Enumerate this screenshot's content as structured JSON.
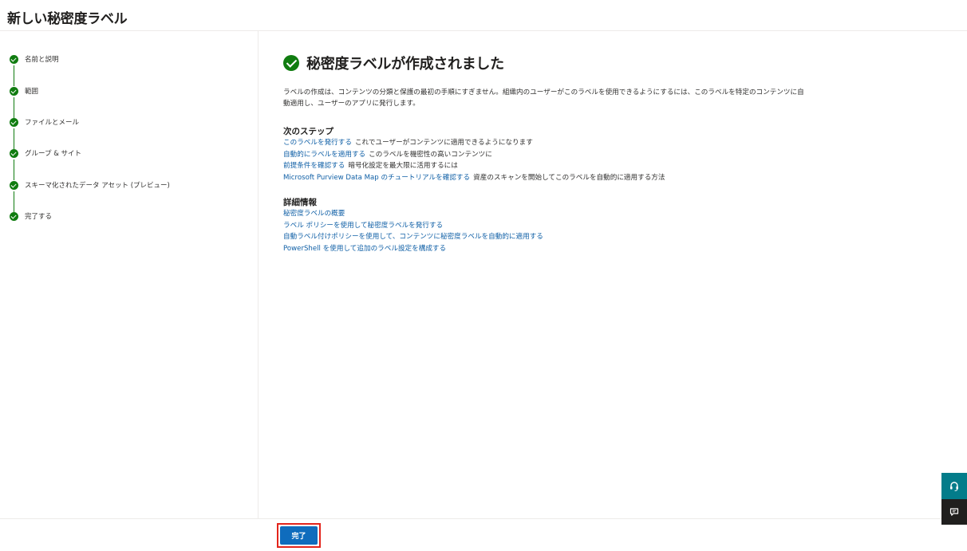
{
  "header": {
    "title": "新しい秘密度ラベル"
  },
  "steps": [
    {
      "label": "名前と説明"
    },
    {
      "label": "範囲"
    },
    {
      "label": "ファイルとメール"
    },
    {
      "label": "グループ & サイト"
    },
    {
      "label": "スキーマ化されたデータ アセット (プレビュー)"
    },
    {
      "label": "完了する"
    }
  ],
  "main": {
    "title": "秘密度ラベルが作成されました",
    "description": "ラベルの作成は、コンテンツの分類と保護の最初の手順にすぎません。組織内のユーザーがこのラベルを使用できるようにするには、このラベルを特定のコンテンツに自動適用し、ユーザーのアプリに発行します。",
    "next_steps": {
      "heading": "次のステップ",
      "items": [
        {
          "link": "このラベルを発行する",
          "text": "これでユーザーがコンテンツに適用できるようになります"
        },
        {
          "link": "自動的にラベルを適用する",
          "text": "このラベルを機密性の高いコンテンツに"
        },
        {
          "link": "前提条件を確認する",
          "text": "暗号化設定を最大限に活用するには"
        },
        {
          "link": "Microsoft Purview Data Map のチュートリアルを確認する",
          "text": "資産のスキャンを開始してこのラベルを自動的に適用する方法"
        }
      ]
    },
    "details": {
      "heading": "詳細情報",
      "links": [
        "秘密度ラベルの概要",
        "ラベル ポリシーを使用して秘密度ラベルを発行する",
        "自動ラベル付けポリシーを使用して、コンテンツに秘密度ラベルを自動的に適用する",
        "PowerShell を使用して追加のラベル設定を構成する"
      ]
    }
  },
  "footer": {
    "done_label": "完了"
  },
  "floating": {
    "help_icon": "headset-icon",
    "feedback_icon": "feedback-icon"
  },
  "colors": {
    "accent": "#0f6cbd",
    "success": "#107c10",
    "link": "#0f5fa6",
    "highlight": "#e3241b",
    "help_bg": "#037c8a"
  }
}
